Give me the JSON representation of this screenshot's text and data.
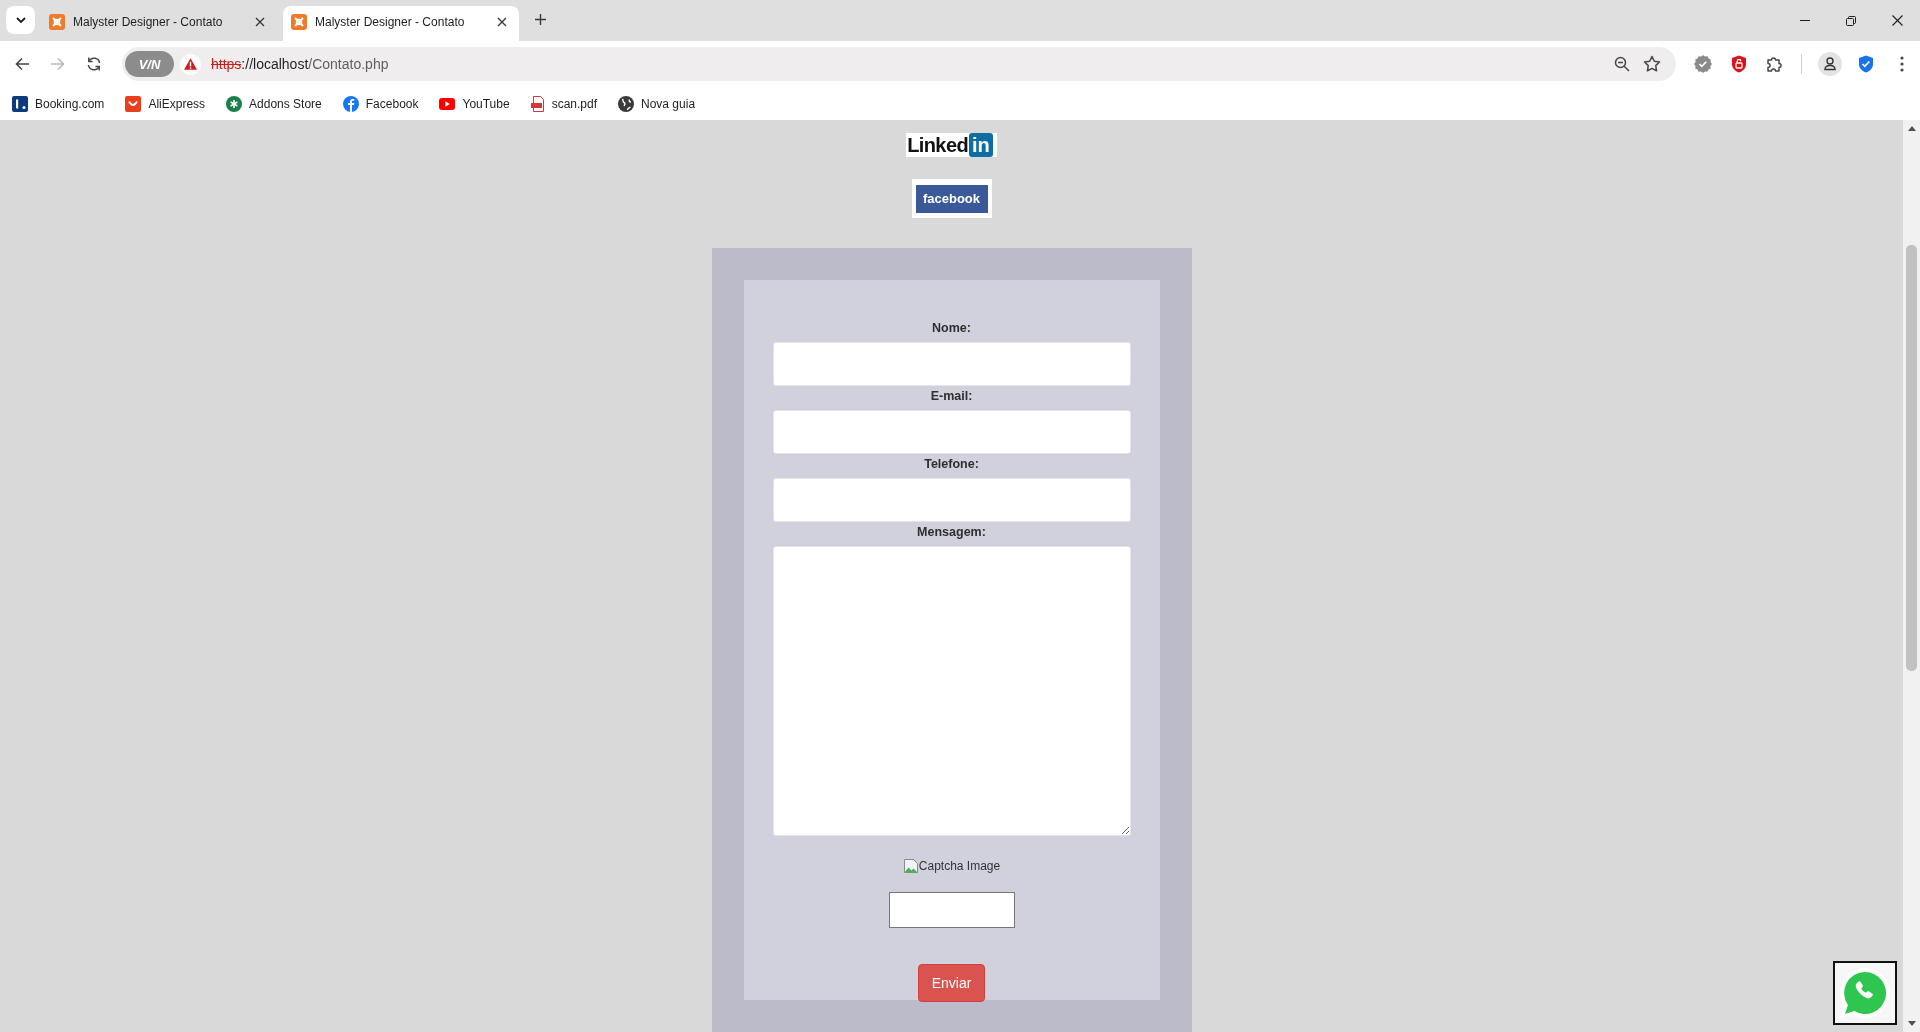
{
  "browser": {
    "tabs": [
      {
        "title": "Malyster Designer - Contato",
        "selected": false
      },
      {
        "title": "Malyster Designer - Contato",
        "selected": true
      }
    ],
    "navigation": {
      "back_disabled": false,
      "forward_disabled": true
    },
    "address_bar": {
      "vpn_badge": "V/N",
      "not_secure": true,
      "scheme": "https",
      "host": "://localhost",
      "path": "/Contato.php"
    },
    "bookmarks": [
      {
        "label": "Booking.com"
      },
      {
        "label": "AliExpress"
      },
      {
        "label": "Addons Store"
      },
      {
        "label": "Facebook"
      },
      {
        "label": "YouTube"
      },
      {
        "label": "scan.pdf"
      },
      {
        "label": "Nova guia"
      }
    ]
  },
  "page": {
    "linkedin_logo": {
      "word": "Linked",
      "badge": "in"
    },
    "facebook_logo": {
      "word": "facebook"
    },
    "form": {
      "fields": [
        {
          "label": "Nome:",
          "kind": "input"
        },
        {
          "label": "E-mail:",
          "kind": "input"
        },
        {
          "label": "Telefone:",
          "kind": "input"
        },
        {
          "label": "Mensagem:",
          "kind": "textarea"
        }
      ],
      "captcha": {
        "image_alt": "Captcha Image"
      },
      "submit_button": "Enviar"
    }
  }
}
